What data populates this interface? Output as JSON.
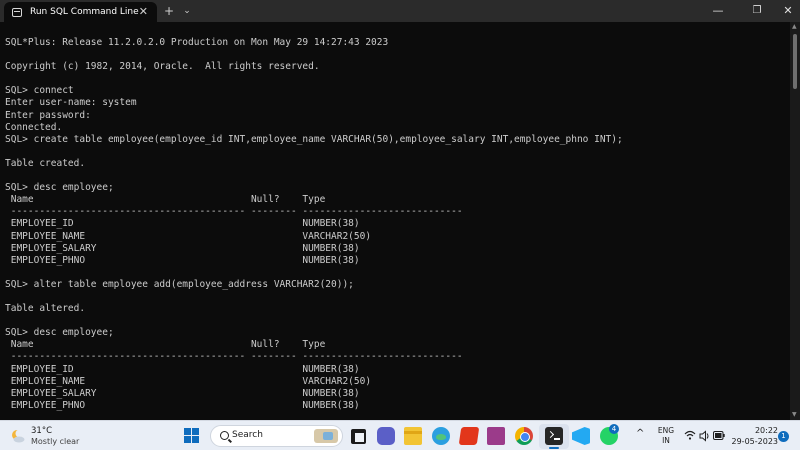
{
  "window": {
    "tab_title": "Run SQL Command Line",
    "tab_close_glyph": "✕",
    "new_tab_glyph": "+",
    "dropdown_glyph": "⌄",
    "minimize_glyph": "—",
    "maximize_glyph": "❐",
    "close_glyph": "✕"
  },
  "terminal": {
    "lines": [
      "SQL*Plus: Release 11.2.0.2.0 Production on Mon May 29 14:27:43 2023",
      "",
      "Copyright (c) 1982, 2014, Oracle.  All rights reserved.",
      "",
      "SQL> connect",
      "Enter user-name: system",
      "Enter password:",
      "Connected.",
      "SQL> create table employee(employee_id INT,employee_name VARCHAR(50),employee_salary INT,employee_phno INT);",
      "",
      "Table created.",
      "",
      "SQL> desc employee;",
      " Name                                      Null?    Type",
      " ----------------------------------------- -------- ----------------------------",
      " EMPLOYEE_ID                                        NUMBER(38)",
      " EMPLOYEE_NAME                                      VARCHAR2(50)",
      " EMPLOYEE_SALARY                                    NUMBER(38)",
      " EMPLOYEE_PHNO                                      NUMBER(38)",
      "",
      "SQL> alter table employee add(employee_address VARCHAR2(20));",
      "",
      "Table altered.",
      "",
      "SQL> desc employee;",
      " Name                                      Null?    Type",
      " ----------------------------------------- -------- ----------------------------",
      " EMPLOYEE_ID                                        NUMBER(38)",
      " EMPLOYEE_NAME                                      VARCHAR2(50)",
      " EMPLOYEE_SALARY                                    NUMBER(38)",
      " EMPLOYEE_PHNO                                      NUMBER(38)"
    ],
    "colors": {
      "background": "#0c0c0c",
      "text": "#cccccc"
    }
  },
  "taskbar": {
    "weather": {
      "temperature": "31°C",
      "condition": "Mostly clear"
    },
    "search": {
      "placeholder": "Search"
    },
    "apps": [
      "task-view",
      "meet",
      "file-explorer",
      "edge",
      "office",
      "winrar",
      "chrome",
      "terminal",
      "vscode",
      "whatsapp"
    ],
    "whatsapp_badge": "4",
    "tray": {
      "chevron_glyph": "^",
      "language_line1": "ENG",
      "language_line2": "IN",
      "time": "20:22",
      "date": "29-05-2023",
      "notification_count": "1"
    }
  }
}
